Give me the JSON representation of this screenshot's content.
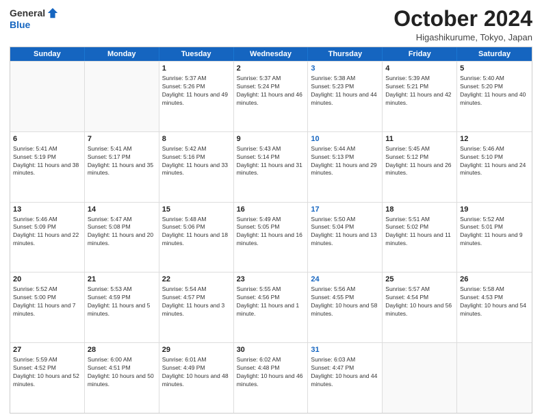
{
  "header": {
    "logo": {
      "general": "General",
      "blue": "Blue"
    },
    "title": "October 2024",
    "location": "Higashikurume, Tokyo, Japan"
  },
  "days_of_week": [
    "Sunday",
    "Monday",
    "Tuesday",
    "Wednesday",
    "Thursday",
    "Friday",
    "Saturday"
  ],
  "weeks": [
    [
      {
        "day": "",
        "empty": true
      },
      {
        "day": "",
        "empty": true
      },
      {
        "day": "1",
        "sunrise": "Sunrise: 5:37 AM",
        "sunset": "Sunset: 5:26 PM",
        "daylight": "Daylight: 11 hours and 49 minutes."
      },
      {
        "day": "2",
        "sunrise": "Sunrise: 5:37 AM",
        "sunset": "Sunset: 5:24 PM",
        "daylight": "Daylight: 11 hours and 46 minutes."
      },
      {
        "day": "3",
        "sunrise": "Sunrise: 5:38 AM",
        "sunset": "Sunset: 5:23 PM",
        "daylight": "Daylight: 11 hours and 44 minutes.",
        "thursday": true
      },
      {
        "day": "4",
        "sunrise": "Sunrise: 5:39 AM",
        "sunset": "Sunset: 5:21 PM",
        "daylight": "Daylight: 11 hours and 42 minutes."
      },
      {
        "day": "5",
        "sunrise": "Sunrise: 5:40 AM",
        "sunset": "Sunset: 5:20 PM",
        "daylight": "Daylight: 11 hours and 40 minutes."
      }
    ],
    [
      {
        "day": "6",
        "sunrise": "Sunrise: 5:41 AM",
        "sunset": "Sunset: 5:19 PM",
        "daylight": "Daylight: 11 hours and 38 minutes."
      },
      {
        "day": "7",
        "sunrise": "Sunrise: 5:41 AM",
        "sunset": "Sunset: 5:17 PM",
        "daylight": "Daylight: 11 hours and 35 minutes."
      },
      {
        "day": "8",
        "sunrise": "Sunrise: 5:42 AM",
        "sunset": "Sunset: 5:16 PM",
        "daylight": "Daylight: 11 hours and 33 minutes."
      },
      {
        "day": "9",
        "sunrise": "Sunrise: 5:43 AM",
        "sunset": "Sunset: 5:14 PM",
        "daylight": "Daylight: 11 hours and 31 minutes."
      },
      {
        "day": "10",
        "sunrise": "Sunrise: 5:44 AM",
        "sunset": "Sunset: 5:13 PM",
        "daylight": "Daylight: 11 hours and 29 minutes.",
        "thursday": true
      },
      {
        "day": "11",
        "sunrise": "Sunrise: 5:45 AM",
        "sunset": "Sunset: 5:12 PM",
        "daylight": "Daylight: 11 hours and 26 minutes."
      },
      {
        "day": "12",
        "sunrise": "Sunrise: 5:46 AM",
        "sunset": "Sunset: 5:10 PM",
        "daylight": "Daylight: 11 hours and 24 minutes."
      }
    ],
    [
      {
        "day": "13",
        "sunrise": "Sunrise: 5:46 AM",
        "sunset": "Sunset: 5:09 PM",
        "daylight": "Daylight: 11 hours and 22 minutes."
      },
      {
        "day": "14",
        "sunrise": "Sunrise: 5:47 AM",
        "sunset": "Sunset: 5:08 PM",
        "daylight": "Daylight: 11 hours and 20 minutes."
      },
      {
        "day": "15",
        "sunrise": "Sunrise: 5:48 AM",
        "sunset": "Sunset: 5:06 PM",
        "daylight": "Daylight: 11 hours and 18 minutes."
      },
      {
        "day": "16",
        "sunrise": "Sunrise: 5:49 AM",
        "sunset": "Sunset: 5:05 PM",
        "daylight": "Daylight: 11 hours and 16 minutes."
      },
      {
        "day": "17",
        "sunrise": "Sunrise: 5:50 AM",
        "sunset": "Sunset: 5:04 PM",
        "daylight": "Daylight: 11 hours and 13 minutes.",
        "thursday": true
      },
      {
        "day": "18",
        "sunrise": "Sunrise: 5:51 AM",
        "sunset": "Sunset: 5:02 PM",
        "daylight": "Daylight: 11 hours and 11 minutes."
      },
      {
        "day": "19",
        "sunrise": "Sunrise: 5:52 AM",
        "sunset": "Sunset: 5:01 PM",
        "daylight": "Daylight: 11 hours and 9 minutes."
      }
    ],
    [
      {
        "day": "20",
        "sunrise": "Sunrise: 5:52 AM",
        "sunset": "Sunset: 5:00 PM",
        "daylight": "Daylight: 11 hours and 7 minutes."
      },
      {
        "day": "21",
        "sunrise": "Sunrise: 5:53 AM",
        "sunset": "Sunset: 4:59 PM",
        "daylight": "Daylight: 11 hours and 5 minutes."
      },
      {
        "day": "22",
        "sunrise": "Sunrise: 5:54 AM",
        "sunset": "Sunset: 4:57 PM",
        "daylight": "Daylight: 11 hours and 3 minutes."
      },
      {
        "day": "23",
        "sunrise": "Sunrise: 5:55 AM",
        "sunset": "Sunset: 4:56 PM",
        "daylight": "Daylight: 11 hours and 1 minute."
      },
      {
        "day": "24",
        "sunrise": "Sunrise: 5:56 AM",
        "sunset": "Sunset: 4:55 PM",
        "daylight": "Daylight: 10 hours and 58 minutes.",
        "thursday": true
      },
      {
        "day": "25",
        "sunrise": "Sunrise: 5:57 AM",
        "sunset": "Sunset: 4:54 PM",
        "daylight": "Daylight: 10 hours and 56 minutes."
      },
      {
        "day": "26",
        "sunrise": "Sunrise: 5:58 AM",
        "sunset": "Sunset: 4:53 PM",
        "daylight": "Daylight: 10 hours and 54 minutes."
      }
    ],
    [
      {
        "day": "27",
        "sunrise": "Sunrise: 5:59 AM",
        "sunset": "Sunset: 4:52 PM",
        "daylight": "Daylight: 10 hours and 52 minutes."
      },
      {
        "day": "28",
        "sunrise": "Sunrise: 6:00 AM",
        "sunset": "Sunset: 4:51 PM",
        "daylight": "Daylight: 10 hours and 50 minutes."
      },
      {
        "day": "29",
        "sunrise": "Sunrise: 6:01 AM",
        "sunset": "Sunset: 4:49 PM",
        "daylight": "Daylight: 10 hours and 48 minutes."
      },
      {
        "day": "30",
        "sunrise": "Sunrise: 6:02 AM",
        "sunset": "Sunset: 4:48 PM",
        "daylight": "Daylight: 10 hours and 46 minutes."
      },
      {
        "day": "31",
        "sunrise": "Sunrise: 6:03 AM",
        "sunset": "Sunset: 4:47 PM",
        "daylight": "Daylight: 10 hours and 44 minutes.",
        "thursday": true
      },
      {
        "day": "",
        "empty": true
      },
      {
        "day": "",
        "empty": true
      }
    ]
  ]
}
